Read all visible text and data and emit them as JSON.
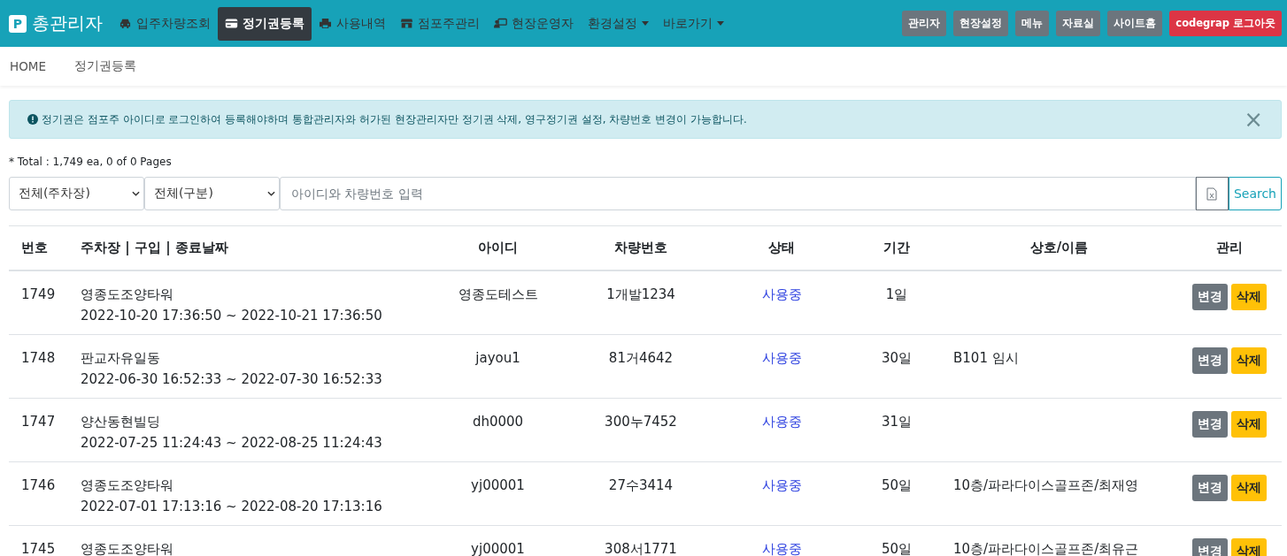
{
  "nav": {
    "brand_mark": "P",
    "brand": "총관리자",
    "items": [
      {
        "label": "입주차량조회",
        "selected": false,
        "dropdown": false
      },
      {
        "label": "정기권등록",
        "selected": true,
        "dropdown": false
      },
      {
        "label": "사용내역",
        "selected": false,
        "dropdown": false
      },
      {
        "label": "점포주관리",
        "selected": false,
        "dropdown": false
      },
      {
        "label": "현장운영자",
        "selected": false,
        "dropdown": false
      },
      {
        "label": "환경설정",
        "selected": false,
        "dropdown": true
      },
      {
        "label": "바로가기",
        "selected": false,
        "dropdown": true
      }
    ],
    "buttons": [
      {
        "label": "관리자",
        "kind": "secondary"
      },
      {
        "label": "현장설정",
        "kind": "secondary"
      },
      {
        "label": "메뉴",
        "kind": "secondary"
      },
      {
        "label": "자료실",
        "kind": "secondary"
      },
      {
        "label": "사이트홈",
        "kind": "secondary"
      },
      {
        "label": "codegrap 로그아웃",
        "kind": "danger"
      }
    ]
  },
  "breadcrumb": [
    "HOME",
    "정기권등록"
  ],
  "alert": {
    "text": "정기권은 점포주 아이디로 로그인하여 등록해야하며 통합관리자와 허가된 현장관리자만 정기권 삭제, 영구정기권 설정, 차량번호 변경이 가능합니다.",
    "close": "×"
  },
  "total": "* Total : 1,749 ea, 0 of 0 Pages",
  "filters": [
    "전체(주차장)",
    "전체(구분)"
  ],
  "search": {
    "placeholder": "아이디와 차량번호 입력",
    "button": "Search"
  },
  "table": {
    "columns": [
      "번호",
      "주차장 | 구입 | 종료날짜",
      "아이디",
      "차량번호",
      "상태",
      "기간",
      "상호/이름",
      "관리"
    ],
    "rows": [
      {
        "no": "1749",
        "lot": "영종도조양타워",
        "period_range": "2022-10-20 17:36:50 ~ 2022-10-21 17:36:50",
        "id": "영종도테스트",
        "car": "1개발1234",
        "status": "사용중",
        "duration": "1일",
        "name": "",
        "actions": [
          {
            "label": "변경",
            "kind": "secondary"
          },
          {
            "label": "삭제",
            "kind": "warning"
          }
        ]
      },
      {
        "no": "1748",
        "lot": "판교자유일동",
        "period_range": "2022-06-30 16:52:33 ~ 2022-07-30 16:52:33",
        "id": "jayou1",
        "car": "81거4642",
        "status": "사용중",
        "duration": "30일",
        "name": "B101 임시",
        "actions": [
          {
            "label": "변경",
            "kind": "secondary"
          },
          {
            "label": "삭제",
            "kind": "warning"
          }
        ]
      },
      {
        "no": "1747",
        "lot": "양산동현빌딩",
        "period_range": "2022-07-25 11:24:43 ~ 2022-08-25 11:24:43",
        "id": "dh0000",
        "car": "300누7452",
        "status": "사용중",
        "duration": "31일",
        "name": "",
        "actions": [
          {
            "label": "변경",
            "kind": "secondary"
          },
          {
            "label": "삭제",
            "kind": "warning"
          }
        ]
      },
      {
        "no": "1746",
        "lot": "영종도조양타워",
        "period_range": "2022-07-01 17:13:16 ~ 2022-08-20 17:13:16",
        "id": "yj00001",
        "car": "27수3414",
        "status": "사용중",
        "duration": "50일",
        "name": "10층/파라다이스골프존/최재영",
        "actions": [
          {
            "label": "변경",
            "kind": "secondary"
          },
          {
            "label": "삭제",
            "kind": "warning"
          }
        ]
      },
      {
        "no": "1745",
        "lot": "영종도조양타워",
        "period_range": "",
        "id": "yj00001",
        "car": "308서1771",
        "status": "사용중",
        "duration": "50일",
        "name": "10층/파라다이스골프존/최유근",
        "actions": [
          {
            "label": "변경",
            "kind": "secondary"
          },
          {
            "label": "삭제",
            "kind": "warning"
          }
        ]
      }
    ]
  }
}
